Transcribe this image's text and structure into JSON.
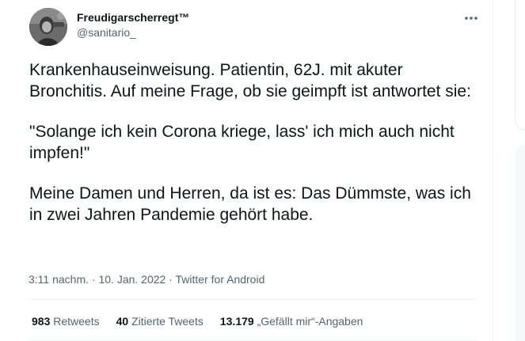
{
  "tweet": {
    "author": {
      "display_name": "Freudigarscherregt™",
      "handle": "@sanitario_"
    },
    "more_icon": "more-horizontal-icon",
    "text": {
      "paragraph_1": "Krankenhauseinweisung. Patientin, 62J. mit akuter Bronchitis. Auf meine Frage, ob sie geimpft ist antwortet sie:",
      "paragraph_2": "\"Solange ich kein Corona kriege, lass' ich mich auch nicht impfen!\"",
      "paragraph_3": "Meine Damen und Herren, da ist es: Das Dümmste, was ich in zwei Jahren Pandemie gehört habe."
    },
    "meta": {
      "time": "3:11 nachm.",
      "separator": "·",
      "date": "10. Jan. 2022",
      "source": "Twitter for Android"
    },
    "stats": {
      "retweets": {
        "count": "983",
        "label": "Retweets"
      },
      "quotes": {
        "count": "40",
        "label": "Zitierte Tweets"
      },
      "likes": {
        "count": "13.179",
        "label": "„Gefällt mir“-Angaben"
      }
    }
  },
  "colors": {
    "text_primary": "#0f1419",
    "text_secondary": "#536471",
    "divider": "#eff3f4"
  }
}
